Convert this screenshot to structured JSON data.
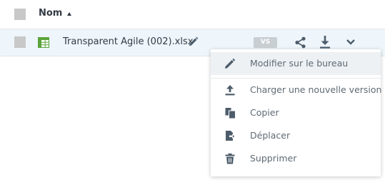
{
  "header": {
    "column_name": "Nom"
  },
  "file": {
    "name": "Transparent Agile (002).xlsx",
    "version_badge": "VS"
  },
  "icons": {
    "file_type": "spreadsheet-icon",
    "rename": "pencil-icon",
    "share": "share-icon",
    "download": "download-icon",
    "more": "chevron-down-icon"
  },
  "menu": {
    "items": [
      {
        "label": "Modifier sur le bureau",
        "icon": "pencil-icon"
      },
      {
        "label": "Charger une nouvelle version",
        "icon": "upload-icon"
      },
      {
        "label": "Copier",
        "icon": "copy-icon"
      },
      {
        "label": "Déplacer",
        "icon": "move-icon"
      },
      {
        "label": "Supprimer",
        "icon": "trash-icon"
      }
    ]
  },
  "colors": {
    "icon": "#4d5d6b",
    "spreadsheet": "#5aa43a",
    "row_highlight": "#eef6fb"
  }
}
